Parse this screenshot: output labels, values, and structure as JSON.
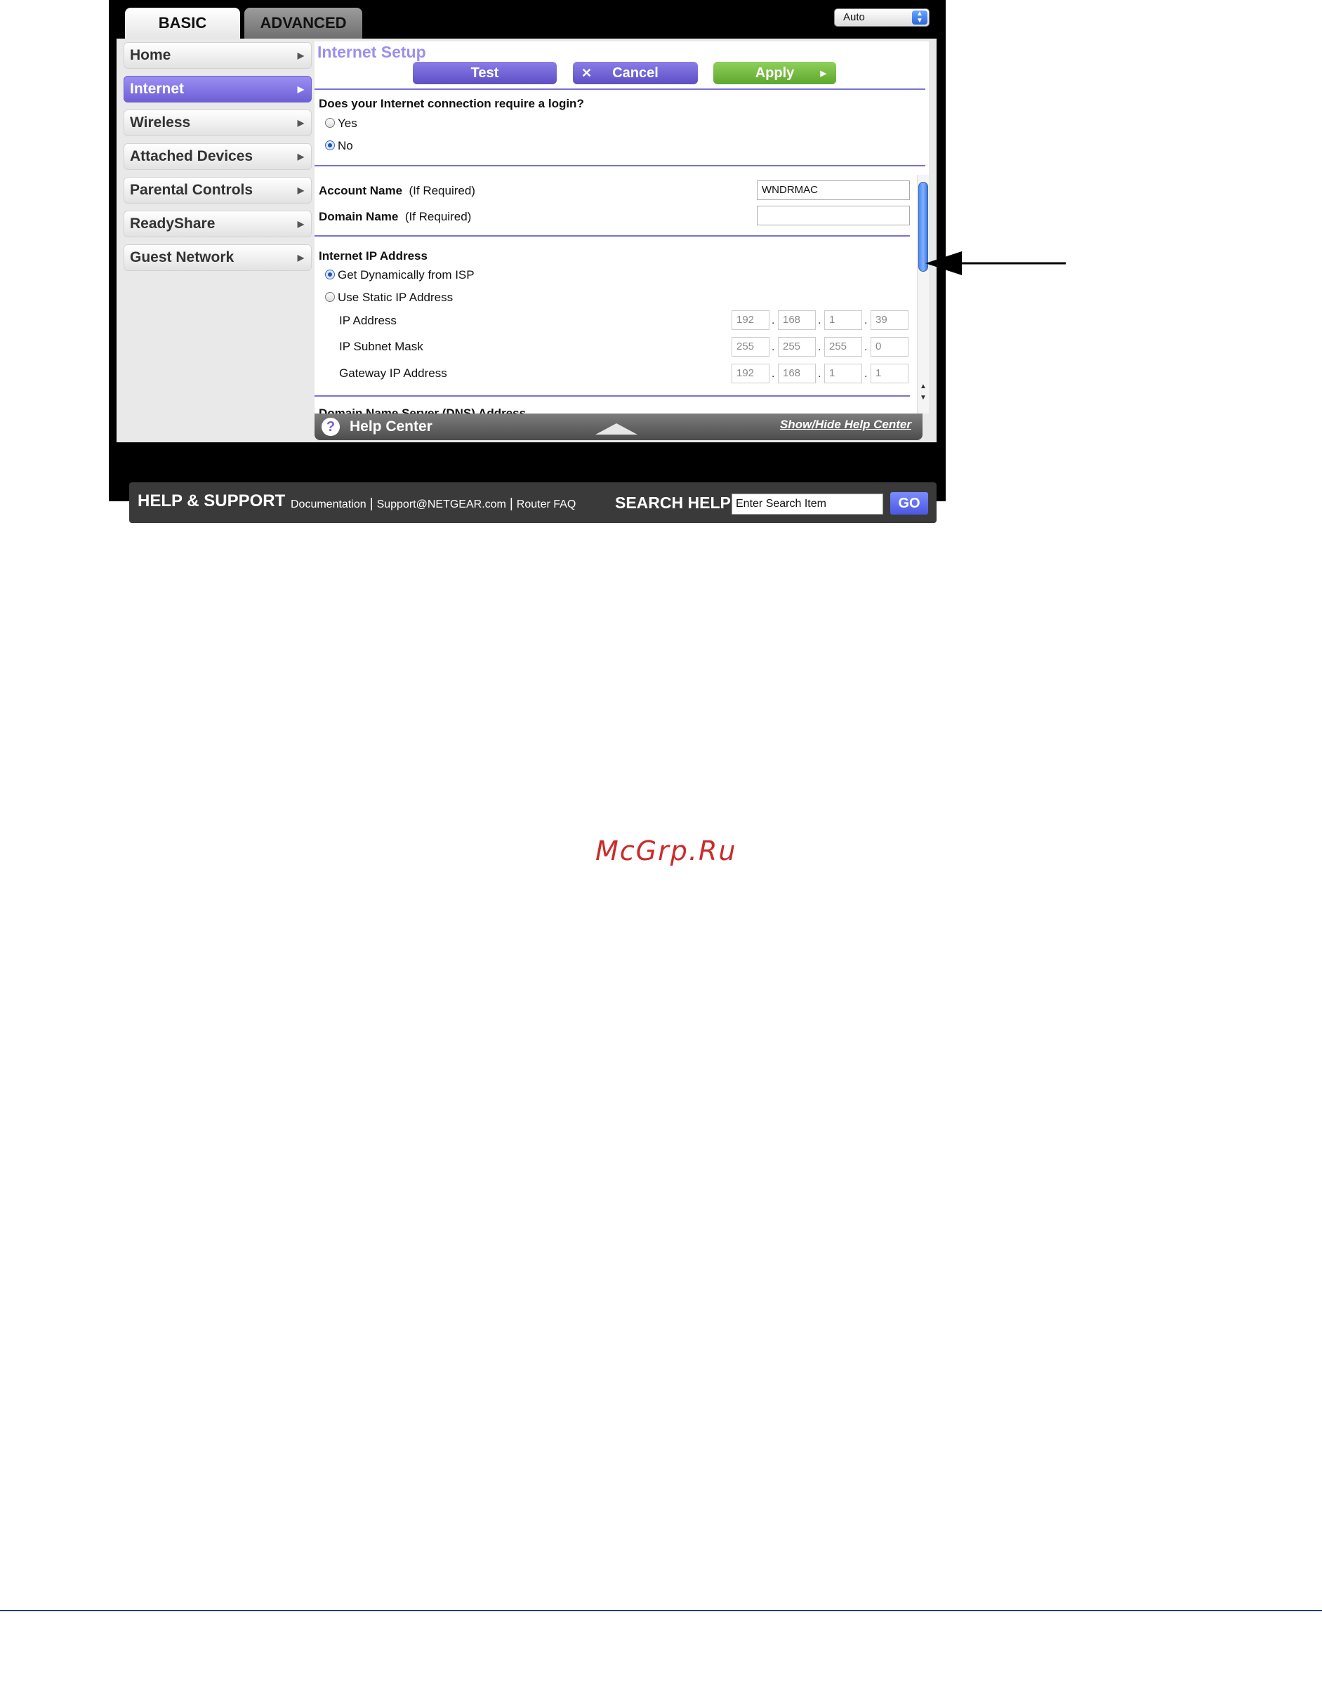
{
  "tabs": {
    "basic": "BASIC",
    "advanced": "ADVANCED"
  },
  "language": {
    "selected": "Auto"
  },
  "sidebar": {
    "items": [
      {
        "label": "Home"
      },
      {
        "label": "Internet"
      },
      {
        "label": "Wireless"
      },
      {
        "label": "Attached Devices"
      },
      {
        "label": "Parental Controls"
      },
      {
        "label": "ReadyShare"
      },
      {
        "label": "Guest Network"
      }
    ]
  },
  "main": {
    "title": "Internet Setup",
    "buttons": {
      "test": "Test",
      "cancel": "Cancel",
      "apply": "Apply"
    },
    "login_question": "Does your Internet connection require a login?",
    "login_options": {
      "yes": "Yes",
      "no": "No"
    },
    "account_name": {
      "label": "Account Name",
      "hint": "(If Required)",
      "value": "WNDRMAC"
    },
    "domain_name": {
      "label": "Domain Name",
      "hint": "(If Required)",
      "value": ""
    },
    "ip_section": {
      "title": "Internet IP Address",
      "dynamic": "Get Dynamically from ISP",
      "static": "Use Static IP Address",
      "ip_address": {
        "label": "IP Address",
        "octets": [
          "192",
          "168",
          "1",
          "39"
        ]
      },
      "subnet_mask": {
        "label": "IP Subnet Mask",
        "octets": [
          "255",
          "255",
          "255",
          "0"
        ]
      },
      "gateway": {
        "label": "Gateway IP Address",
        "octets": [
          "192",
          "168",
          "1",
          "1"
        ]
      }
    },
    "dns_section": {
      "title": "Domain Name Server (DNS) Address"
    }
  },
  "help_center": {
    "title": "Help Center",
    "toggle_link": "Show/Hide Help Center"
  },
  "footer": {
    "title": "HELP & SUPPORT",
    "links": [
      "Documentation",
      "Support@NETGEAR.com",
      "Router FAQ"
    ],
    "search_title": "SEARCH HELP",
    "search_placeholder": "Enter Search Item",
    "go": "GO"
  },
  "watermark": "McGrp.Ru",
  "icons": {
    "help": "question-icon",
    "cancel": "x-icon",
    "apply": "play-icon",
    "nav": "chevron-right-icon"
  },
  "colors": {
    "accent": "#7a70d8",
    "apply": "#6cb33a",
    "title": "#9a8ff0"
  }
}
